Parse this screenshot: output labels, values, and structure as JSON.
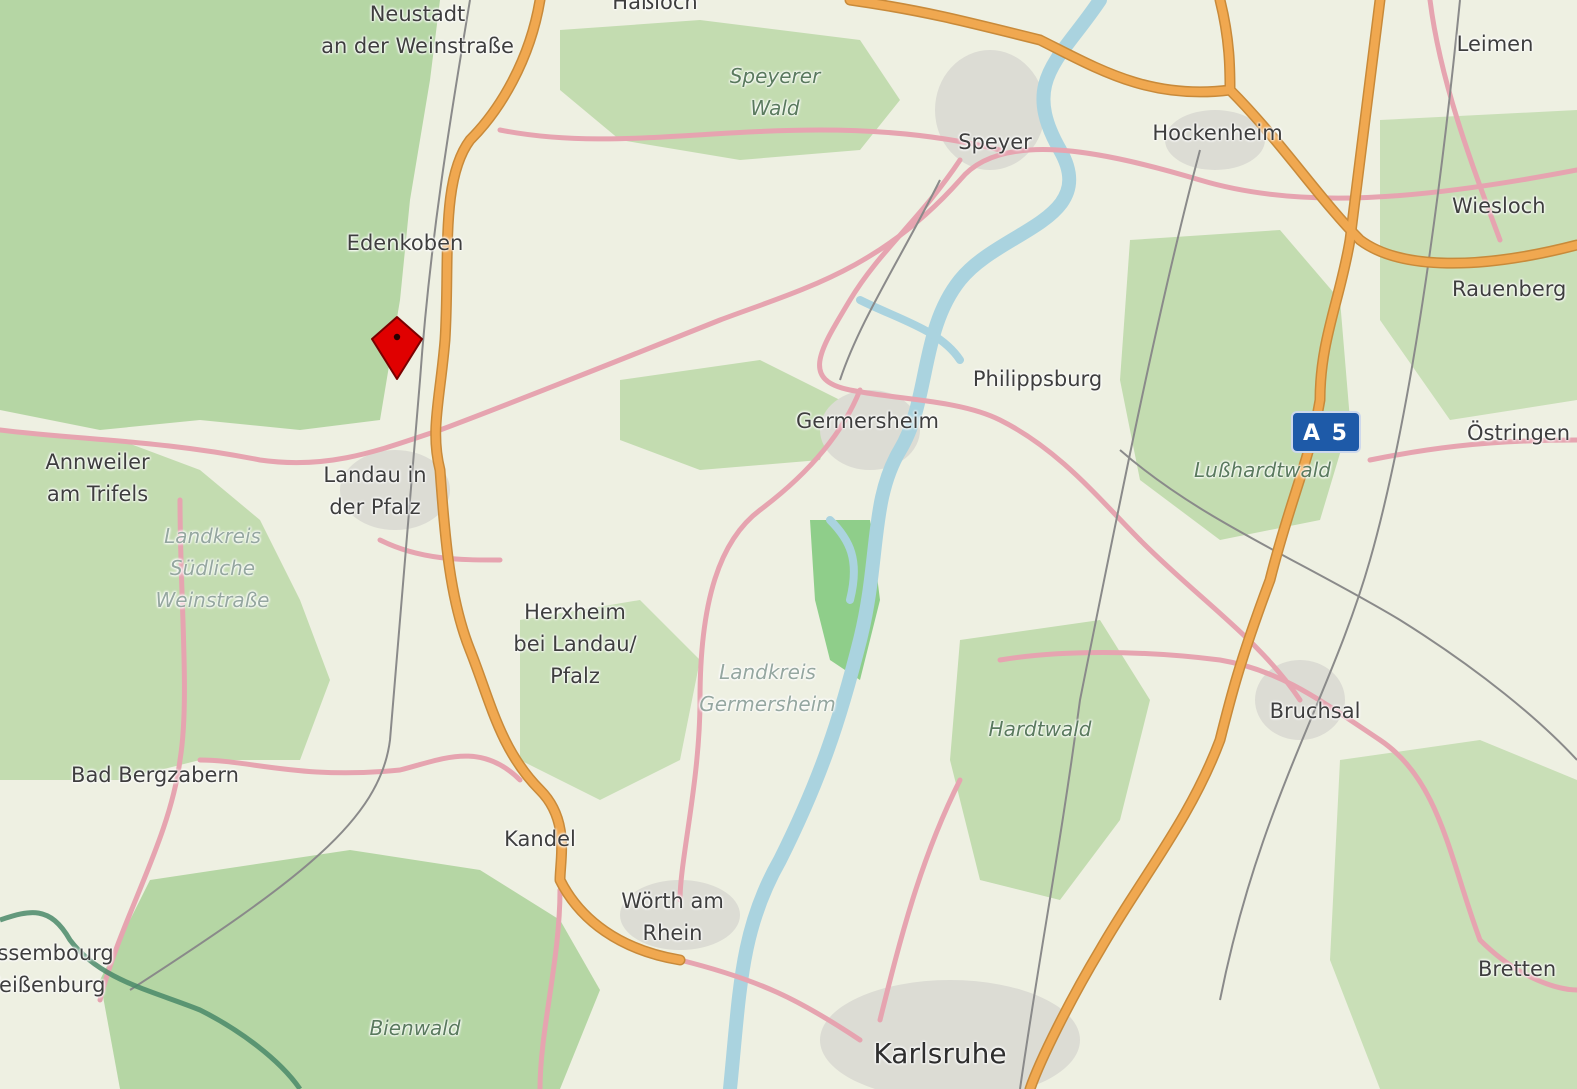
{
  "map": {
    "labels": {
      "neustadt": "Neustadt\nan der Weinstraße",
      "hassloch": "Haßloch",
      "leimen": "Leimen",
      "speyerer_wald": "Speyerer\nWald",
      "speyer": "Speyer",
      "hockenheim": "Hockenheim",
      "wiesloch": "Wiesloch",
      "rauenberg": "Rauenberg",
      "edenkoben": "Edenkoben",
      "philippsburg": "Philippsburg",
      "germersheim": "Germersheim",
      "ostringen": "Östringen",
      "annweiler": "Annweiler\nam Trifels",
      "landau": "Landau in\nder Pfalz",
      "lusshardtwald": "Lußhardtwald",
      "landkreis_suedliche": "Landkreis\nSüdliche\nWeinstraße",
      "herxheim": "Herxheim\nbei Landau/\nPfalz",
      "landkreis_germersheim": "Landkreis\nGermersheim",
      "hardtwald": "Hardtwald",
      "bruchsal": "Bruchsal",
      "bad_bergzabern": "Bad Bergzabern",
      "kandel": "Kandel",
      "woerth": "Wörth am\nRhein",
      "wissembourg": "Wissembourg\nWeißenburg",
      "bretten": "Bretten",
      "bienwald": "Bienwald",
      "karlsruhe": "Karlsruhe"
    },
    "shield": {
      "label": "A 5",
      "color": "#1e5aa8"
    },
    "marker": {
      "icon": "map-pin-icon",
      "color": "#e00000"
    },
    "colors": {
      "background": "#eef0e2",
      "forest": "#b5d6a4",
      "motorway": "#f0a850",
      "primary_road": "#e6a4b0",
      "water": "#aad3df",
      "rail": "#8a8a8a",
      "border": "#4a8a6a"
    }
  }
}
